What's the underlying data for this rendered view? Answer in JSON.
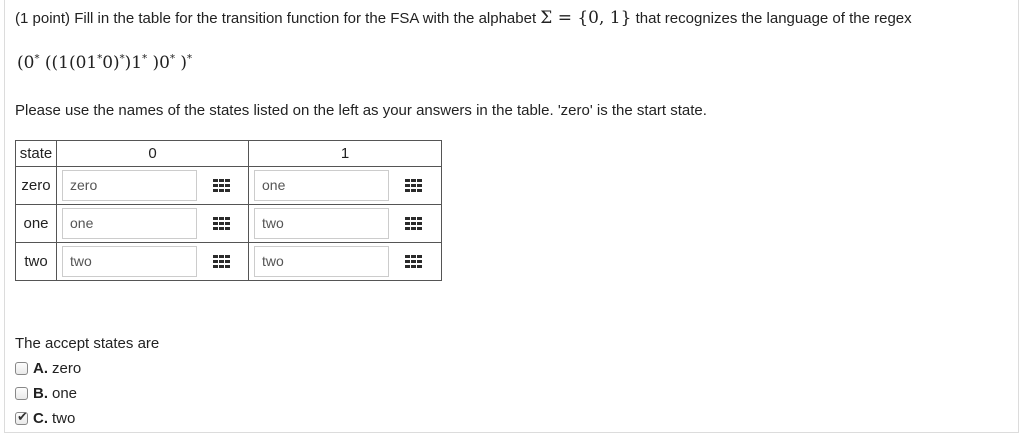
{
  "question": {
    "prefix": "(1 point) Fill in the table for the transition function for the FSA with the alphabet ",
    "alphabet_math": "Σ = {0, 1}",
    "suffix": " that recognizes the language of the regex",
    "regex_parts": [
      "(0",
      "*",
      " ((1(01",
      "*",
      "0)",
      "*",
      ")1",
      "*",
      " )0",
      "*",
      " )",
      "*"
    ],
    "instruction": "Please use the names of the states listed on the left as your answers in the table. 'zero' is the start state."
  },
  "table": {
    "headers": [
      "state",
      "0",
      "1"
    ],
    "rows": [
      {
        "state": "zero",
        "on0": "zero",
        "on1": "one"
      },
      {
        "state": "one",
        "on0": "one",
        "on1": "two"
      },
      {
        "state": "two",
        "on0": "two",
        "on1": "two"
      }
    ],
    "icon": "keypad-grid-icon"
  },
  "accept": {
    "prompt": "The accept states are",
    "options": [
      {
        "letter": "A.",
        "label": "zero",
        "checked": false
      },
      {
        "letter": "B.",
        "label": "one",
        "checked": false
      },
      {
        "letter": "C.",
        "label": "two",
        "checked": true
      }
    ],
    "check_glyph": "✔"
  }
}
